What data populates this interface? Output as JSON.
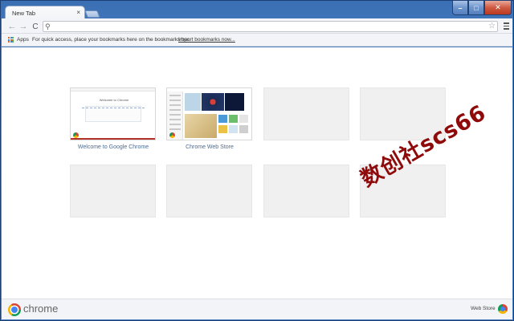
{
  "window": {
    "tab_title": "New Tab",
    "tab_close": "×",
    "minimize": "–",
    "maximize": "□",
    "close": "✕"
  },
  "toolbar": {
    "back_icon": "←",
    "forward_icon": "→",
    "reload_icon": "C",
    "search_icon": "⚲",
    "omnibox_value": "",
    "star_icon": "☆"
  },
  "bookmarks_bar": {
    "apps_label": "Apps",
    "hint": "For quick access, place your bookmarks here on the bookmarks bar.",
    "import_link": "Import bookmarks now..."
  },
  "most_visited": [
    {
      "title": "Welcome to Google Chrome",
      "thumbnail_heading": "Welcome to Chrome"
    },
    {
      "title": "Chrome Web Store"
    },
    {
      "title": ""
    },
    {
      "title": ""
    },
    {
      "title": ""
    },
    {
      "title": ""
    },
    {
      "title": ""
    },
    {
      "title": ""
    }
  ],
  "watermark": "数创社scs66",
  "bottom_bar": {
    "brand": "chrome",
    "web_store_label": "Web Store"
  },
  "colors": {
    "frame_blue": "#4a80c2",
    "link_text": "#4b6c93",
    "watermark": "#8f0a0a"
  }
}
